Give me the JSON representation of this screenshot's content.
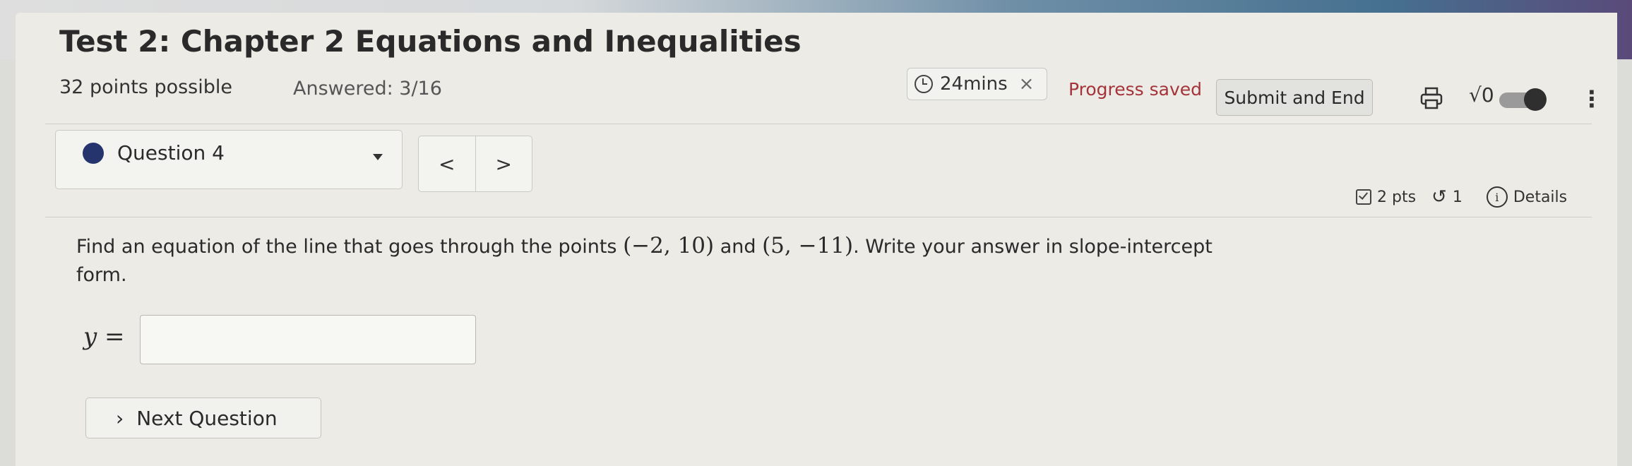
{
  "header": {
    "title": "Test 2: Chapter 2 Equations and Inequalities",
    "points": "32 points possible",
    "answered": "Answered: 3/16",
    "timer": "24mins",
    "progress_status": "Progress saved",
    "submit_label": "Submit and End",
    "sqrt_label": "√0"
  },
  "question_nav": {
    "selected": "Question 4",
    "prev_label": "<",
    "next_label": ">"
  },
  "question_meta": {
    "points": "2 pts",
    "attempts": "1",
    "details_label": "Details"
  },
  "question": {
    "text_1": "Find an equation of the line that goes through the points ",
    "point_1": "(−2, 10)",
    "text_2": " and ",
    "point_2": "(5, −11)",
    "text_3": ". Write your answer in slope-intercept form.",
    "answer_prefix": "y =",
    "answer_value": ""
  },
  "footer": {
    "next_question_label": "Next Question"
  },
  "colors": {
    "progress_saved": "#a4343a",
    "question_dot": "#26346d"
  }
}
